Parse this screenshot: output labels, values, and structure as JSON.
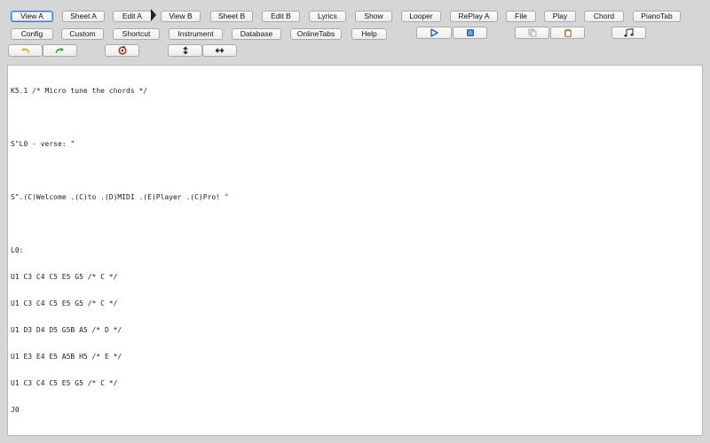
{
  "toolbar_row1": [
    {
      "label": "View A",
      "active": true
    },
    {
      "label": "Sheet A"
    },
    {
      "label": "Edit A"
    },
    {
      "label": "View B"
    },
    {
      "label": "Sheet B"
    },
    {
      "label": "Edit B"
    },
    {
      "label": "Lyrics"
    },
    {
      "label": "Show"
    },
    {
      "label": "Looper"
    },
    {
      "label": "RePlay A"
    },
    {
      "label": "File"
    },
    {
      "label": "Play"
    },
    {
      "label": "Chord"
    },
    {
      "label": "PianoTab"
    }
  ],
  "toolbar_row2": [
    {
      "label": "Config"
    },
    {
      "label": "Custom"
    },
    {
      "label": "Shortcut"
    },
    {
      "label": "Instrument"
    },
    {
      "label": "Database"
    },
    {
      "label": "OnlineTabs"
    },
    {
      "label": "Help"
    }
  ],
  "icons": {
    "play": "play-icon",
    "stop": "stop-icon",
    "copy": "copy-icon",
    "paste": "paste-icon",
    "notes": "music-notes-icon",
    "undo": "undo-icon",
    "redo": "redo-icon",
    "record": "record-icon",
    "vertical": "vertical-resize-icon",
    "horizontal": "horizontal-resize-icon"
  },
  "colors": {
    "toolbar_bg": "#d6d6d6",
    "active_border": "#3b7bd6",
    "play_accent": "#2a5d9e",
    "record_red": "#c0282a",
    "undo_yellow": "#e0b020",
    "redo_green": "#3f9e3a"
  },
  "editor": {
    "lines": [
      "K5.1 /* Micro tune the chords */",
      "",
      "S\"L0 - verse: \"",
      "",
      "S\".(C)Welcome .(C)to .(D)MIDI .(E)Player .(C)Pro! \"",
      "",
      "L0:",
      "U1 C3 C4 C5 E5 G5 /* C */",
      "U1 C3 C4 C5 E5 G5 /* C */",
      "U1 D3 D4 D5 G5B A5 /* D */",
      "U1 E3 E4 E5 A5B H5 /* E */",
      "U1 C3 C4 C5 E5 G5 /* C */",
      "J0"
    ]
  }
}
